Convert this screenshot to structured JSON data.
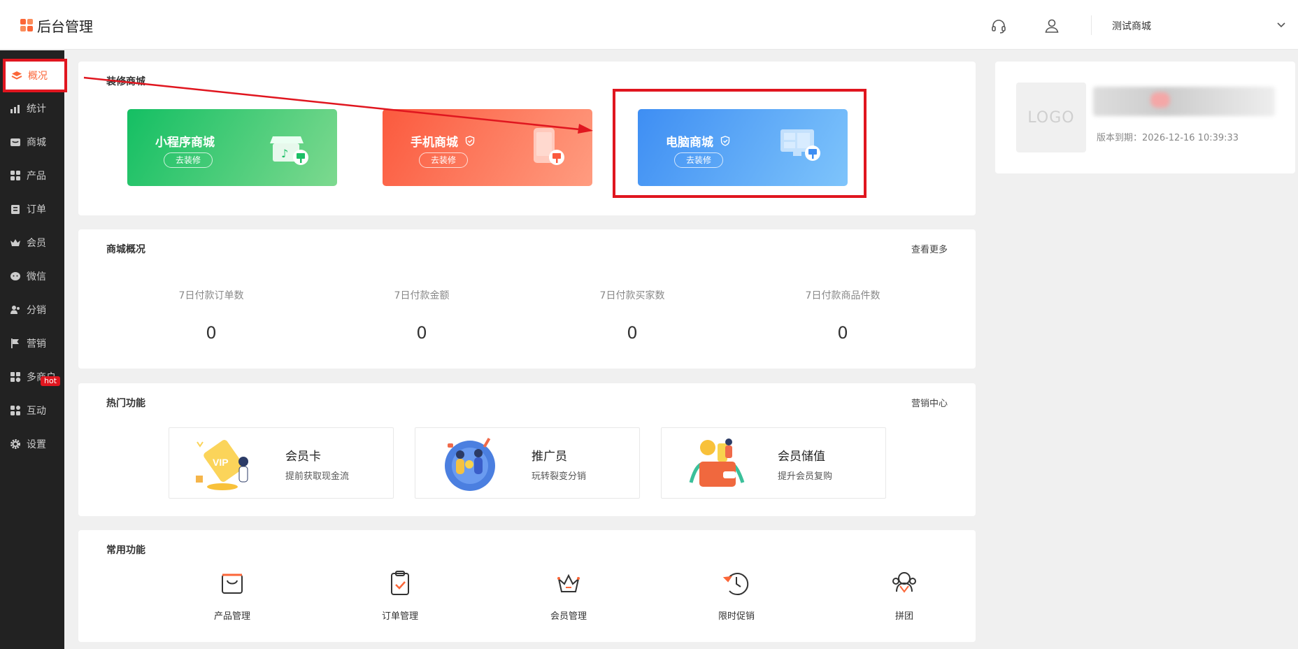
{
  "header": {
    "title": "后台管理",
    "shop_name": "测试商城",
    "icons": [
      "headset-icon",
      "user-icon",
      "chevron-down-icon"
    ]
  },
  "sidebar": {
    "items": [
      {
        "label": "概况",
        "icon": "layers-icon",
        "active": true
      },
      {
        "label": "统计",
        "icon": "chart-icon"
      },
      {
        "label": "商城",
        "icon": "shop-icon"
      },
      {
        "label": "产品",
        "icon": "grid-icon"
      },
      {
        "label": "订单",
        "icon": "clipboard-icon"
      },
      {
        "label": "会员",
        "icon": "crown-icon"
      },
      {
        "label": "微信",
        "icon": "wechat-icon"
      },
      {
        "label": "分销",
        "icon": "people-icon"
      },
      {
        "label": "营销",
        "icon": "flag-icon",
        "badge": "hot"
      },
      {
        "label": "多商户",
        "icon": "store-icon"
      },
      {
        "label": "互动",
        "icon": "interact-icon"
      },
      {
        "label": "设置",
        "icon": "gear-icon"
      }
    ]
  },
  "decorate": {
    "title": "装修商城",
    "cards": [
      {
        "name": "小程序商城",
        "button": "去装修",
        "color": "#2ec06a"
      },
      {
        "name": "手机商城",
        "button": "去装修",
        "color": "#fb6a4a"
      },
      {
        "name": "电脑商城",
        "button": "去装修",
        "color": "#4a9cf5"
      }
    ]
  },
  "overview": {
    "title": "商城概况",
    "more": "查看更多",
    "stats": [
      {
        "label": "7日付款订单数",
        "value": "0"
      },
      {
        "label": "7日付款金额",
        "value": "0"
      },
      {
        "label": "7日付款买家数",
        "value": "0"
      },
      {
        "label": "7日付款商品件数",
        "value": "0"
      }
    ]
  },
  "hot": {
    "title": "热门功能",
    "more": "营销中心",
    "items": [
      {
        "name": "会员卡",
        "desc": "提前获取现金流"
      },
      {
        "name": "推广员",
        "desc": "玩转裂变分销"
      },
      {
        "name": "会员储值",
        "desc": "提升会员复购"
      }
    ]
  },
  "common": {
    "title": "常用功能",
    "items": [
      {
        "label": "产品管理",
        "icon": "bag-icon"
      },
      {
        "label": "订单管理",
        "icon": "order-check-icon"
      },
      {
        "label": "会员管理",
        "icon": "crown-icon"
      },
      {
        "label": "限时促销",
        "icon": "clock-icon"
      },
      {
        "label": "拼团",
        "icon": "group-icon"
      }
    ]
  },
  "profile": {
    "logo_text": "LOGO",
    "expire": "版本到期：2026-12-16 10:39:33"
  },
  "colors": {
    "accent": "#fb6638",
    "highlight": "#e0161f",
    "sidebar": "#222222"
  }
}
